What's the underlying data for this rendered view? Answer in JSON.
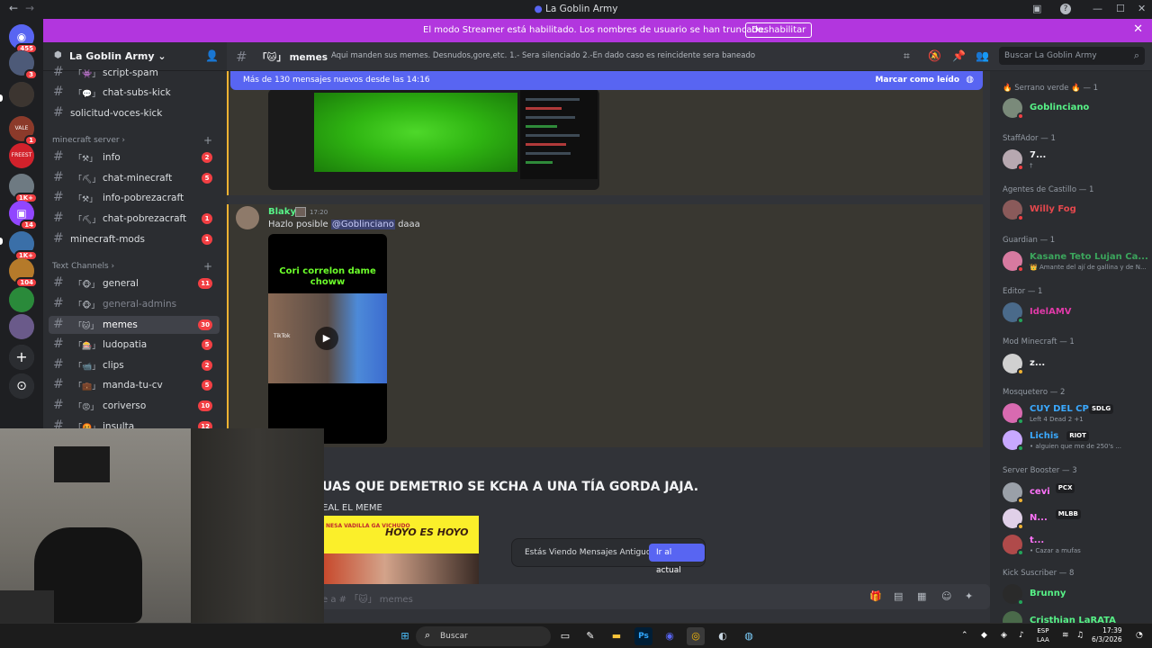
{
  "window": {
    "title": "La Goblin Army",
    "back": "←",
    "forward": "→",
    "inbox_icon": "inbox-icon",
    "help": "?",
    "minimize": "—",
    "maximize": "☐",
    "close": "✕"
  },
  "banner": {
    "text": "El modo Streamer está habilitado. Los nombres de usuario se han truncado.",
    "button": "Deshabilitar",
    "close": "✕"
  },
  "servers": [
    {
      "name": "discord-home",
      "glyph": "◉",
      "badge": "455",
      "color": "#5865f2"
    },
    {
      "name": "server-1",
      "glyph": "",
      "badge": "3",
      "color": "#4d5a78"
    },
    {
      "name": "server-2",
      "glyph": "",
      "badge": "",
      "color": "#3c3530"
    },
    {
      "name": "server-3",
      "glyph": "VALE",
      "badge": "1",
      "color": "#8c3a2a"
    },
    {
      "name": "server-4",
      "glyph": "FREEST",
      "badge": "",
      "color": "#d2212b"
    },
    {
      "name": "server-5",
      "glyph": "",
      "badge": "1K+",
      "color": "#6e7a82"
    },
    {
      "name": "server-twitch",
      "glyph": "▣",
      "badge": "14",
      "color": "#9146ff"
    },
    {
      "name": "server-7",
      "glyph": "",
      "badge": "1K+",
      "color": "#3a6fa8"
    },
    {
      "name": "server-8",
      "glyph": "",
      "badge": "104",
      "color": "#b57a2a"
    },
    {
      "name": "server-9",
      "glyph": "",
      "badge": "",
      "color": "#2a8a3a"
    },
    {
      "name": "server-10",
      "glyph": "",
      "badge": "",
      "color": "#6a5a8a"
    }
  ],
  "rail_actions": {
    "add": "+",
    "discover": "⊙"
  },
  "sidebar": {
    "server_name": "La Goblin Army",
    "chevron": "⌄",
    "channels_top": [
      {
        "emoji": "「👾」",
        "label": "script-spam",
        "count": ""
      },
      {
        "emoji": "「💬」",
        "label": "chat-subs-kick",
        "count": ""
      },
      {
        "emoji": "",
        "label": "solicitud-voces-kick",
        "count": ""
      }
    ],
    "cat_minecraft": "minecraft server",
    "channels_mc": [
      {
        "emoji": "「⚒」",
        "label": "info",
        "count": "2"
      },
      {
        "emoji": "「⛏」",
        "label": "chat-minecraft",
        "count": "5"
      },
      {
        "emoji": "「⚒」",
        "label": "info-pobrezacraft",
        "count": ""
      },
      {
        "emoji": "「⛏」",
        "label": "chat-pobrezacraft",
        "count": "1"
      },
      {
        "emoji": "",
        "label": "minecraft-mods",
        "count": "1"
      }
    ],
    "cat_text": "Text Channels",
    "channels_text": [
      {
        "emoji": "「🐵」",
        "label": "general",
        "count": "11"
      },
      {
        "emoji": "「🐵」",
        "label": "general-admins",
        "count": ""
      },
      {
        "emoji": "「🐱」",
        "label": "memes",
        "count": "30"
      },
      {
        "emoji": "「🎰」",
        "label": "ludopatia",
        "count": "5"
      },
      {
        "emoji": "「📹」",
        "label": "clips",
        "count": "2"
      },
      {
        "emoji": "「💼」",
        "label": "manda-tu-cv",
        "count": "5"
      },
      {
        "emoji": "「😡」",
        "label": "coriverso",
        "count": "10"
      },
      {
        "emoji": "「🤬」",
        "label": "insulta",
        "count": "12"
      }
    ]
  },
  "header": {
    "channel": "「🐱」 memes",
    "topic": "Aqui manden sus memes. Desnudos,gore,etc. 1.- Sera silenciado 2.-En dado caso es reincidente sera baneado",
    "search_placeholder": "Buscar La Goblin Army"
  },
  "chat": {
    "new_messages": "Más de 130 mensajes nuevos desde las 14:16",
    "mark_read": "Marcar como leído",
    "author": "Blaky",
    "time": "17:20",
    "text_pre": "Hazlo posible",
    "mention": "@Goblinciano",
    "text_post": "daaa",
    "tiktok_caption": "Cori correlon dame choww",
    "tiktok_logo": "TikTok",
    "big_message": "UAS QUE DEMETRIO SE KCHA A UNA TÍA GORDA JAJA.",
    "real_meme": "EAL EL MEME",
    "meme_text": "HOYO ES HOYO",
    "meme_left": "NESA VADILLA GA VICHUDO",
    "old_messages": "Estás Viendo Mensajes Antiguos",
    "to_current": "Ir al actual",
    "composer_placeholder": "e a # 「🐱」 memes"
  },
  "members": {
    "roles": [
      "🔥 Serrano verde 🔥 — 1",
      "StaffAdor — 1",
      "Agentes de Castillo — 1",
      "Guardian — 1",
      "Editor — 1",
      "Mod Minecraft — 1",
      "Mosquetero — 2",
      "Server Booster — 3",
      "Kick Suscriber — 8"
    ],
    "list": [
      {
        "name": "Goblinciano",
        "status": "",
        "color": "#57f287",
        "dot": "#f23f43"
      },
      {
        "name": "7...",
        "status": "†",
        "color": "#f2f3f5",
        "dot": "#f23f43"
      },
      {
        "name": "Willy Fog",
        "status": "",
        "color": "#e5484d",
        "dot": "#f23f43"
      },
      {
        "name": "Kasane Teto Lujan Ca...",
        "status": "👑 Amante del ají de gallina y de N...",
        "color": "#3ba55c",
        "dot": "#f23f43"
      },
      {
        "name": "IdelAMV",
        "status": "",
        "color": "#e03aa8",
        "dot": "#23a55a"
      },
      {
        "name": "z...",
        "status": "",
        "color": "#f2f3f5",
        "dot": "#f0b232"
      },
      {
        "name": "CUY DEL CP",
        "status": "Left 4 Dead 2 +1",
        "color": "#3aa9ff",
        "dot": "#23a55a",
        "tag": "SDLG"
      },
      {
        "name": "Lichis",
        "status": "• alguien que me de 250's ...",
        "color": "#3aa9ff",
        "dot": "#23a55a",
        "tag": "RIOT"
      },
      {
        "name": "cevi",
        "status": "",
        "color": "#ff73fa",
        "dot": "#f0b232",
        "tag": "PCX"
      },
      {
        "name": "N...",
        "status": "",
        "color": "#ff73fa",
        "dot": "#f0b232",
        "tag": "MLBB"
      },
      {
        "name": "t...",
        "status": "• Cazar a mufas",
        "color": "#ff73fa",
        "dot": "#23a55a"
      },
      {
        "name": "Brunny",
        "status": "",
        "color": "#57f287",
        "dot": "#23a55a"
      },
      {
        "name": "Cristhian LaRATA",
        "status": "",
        "color": "#57f287",
        "dot": "#23a55a"
      }
    ]
  },
  "taskbar": {
    "search": "Buscar",
    "lang1": "ESP",
    "lang2": "LAA",
    "time": "17:39",
    "date": "6/3/2026",
    "apps": [
      "start-icon",
      "file-explorer-icon",
      "notepad-icon",
      "folder-icon",
      "photoshop-icon",
      "discord-icon",
      "chrome-icon",
      "steam-icon",
      "browser-icon"
    ],
    "ps": "Ps"
  }
}
